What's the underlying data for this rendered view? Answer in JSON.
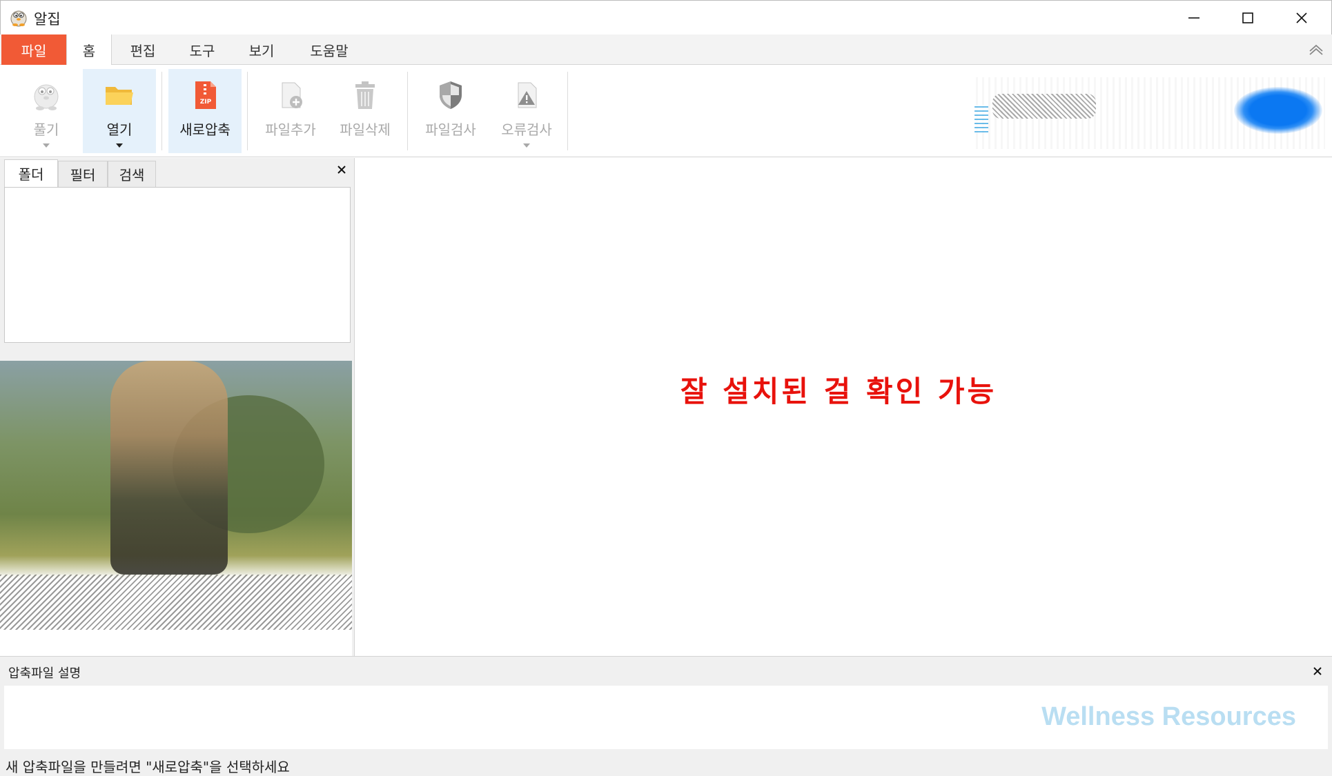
{
  "window": {
    "title": "알집",
    "icon": "alzip-mascot-icon"
  },
  "window_controls": [
    "minimize-icon",
    "maximize-icon",
    "close-icon"
  ],
  "ribbon_tabs": [
    {
      "label": "파일",
      "kind": "file"
    },
    {
      "label": "홈",
      "active": true
    },
    {
      "label": "편집"
    },
    {
      "label": "도구"
    },
    {
      "label": "보기"
    },
    {
      "label": "도움말"
    }
  ],
  "ribbon_buttons": [
    {
      "label": "풀기",
      "icon": "extract-mascot-icon",
      "enabled": false,
      "dropdown": true
    },
    {
      "label": "열기",
      "icon": "folder-open-icon",
      "enabled": true,
      "dropdown": true,
      "highlighted": true
    },
    {
      "label": "새로압축",
      "icon": "zip-file-icon",
      "enabled": true,
      "dropdown": false,
      "highlighted": true
    },
    {
      "label": "파일추가",
      "icon": "file-add-icon",
      "enabled": false,
      "dropdown": false
    },
    {
      "label": "파일삭제",
      "icon": "trash-icon",
      "enabled": false,
      "dropdown": false
    },
    {
      "label": "파일검사",
      "icon": "shield-icon",
      "enabled": false,
      "dropdown": false
    },
    {
      "label": "오류검사",
      "icon": "warning-file-icon",
      "enabled": false,
      "dropdown": true
    }
  ],
  "left_panel": {
    "tabs": [
      "폴더",
      "필터",
      "검색"
    ],
    "active_tab": 0
  },
  "main": {
    "notice": "잘 설치된 걸 확인 가능"
  },
  "description_panel": {
    "title": "압축파일 설명",
    "watermark": "Wellness Resources"
  },
  "status_bar": {
    "text": "새 압축파일을 만들려면 \"새로압축\"을 선택하세요"
  },
  "colors": {
    "file_tab": "#f15a36",
    "notice": "#e8120c",
    "highlight": "#e5f1fb",
    "watermark": "#b9def2"
  }
}
